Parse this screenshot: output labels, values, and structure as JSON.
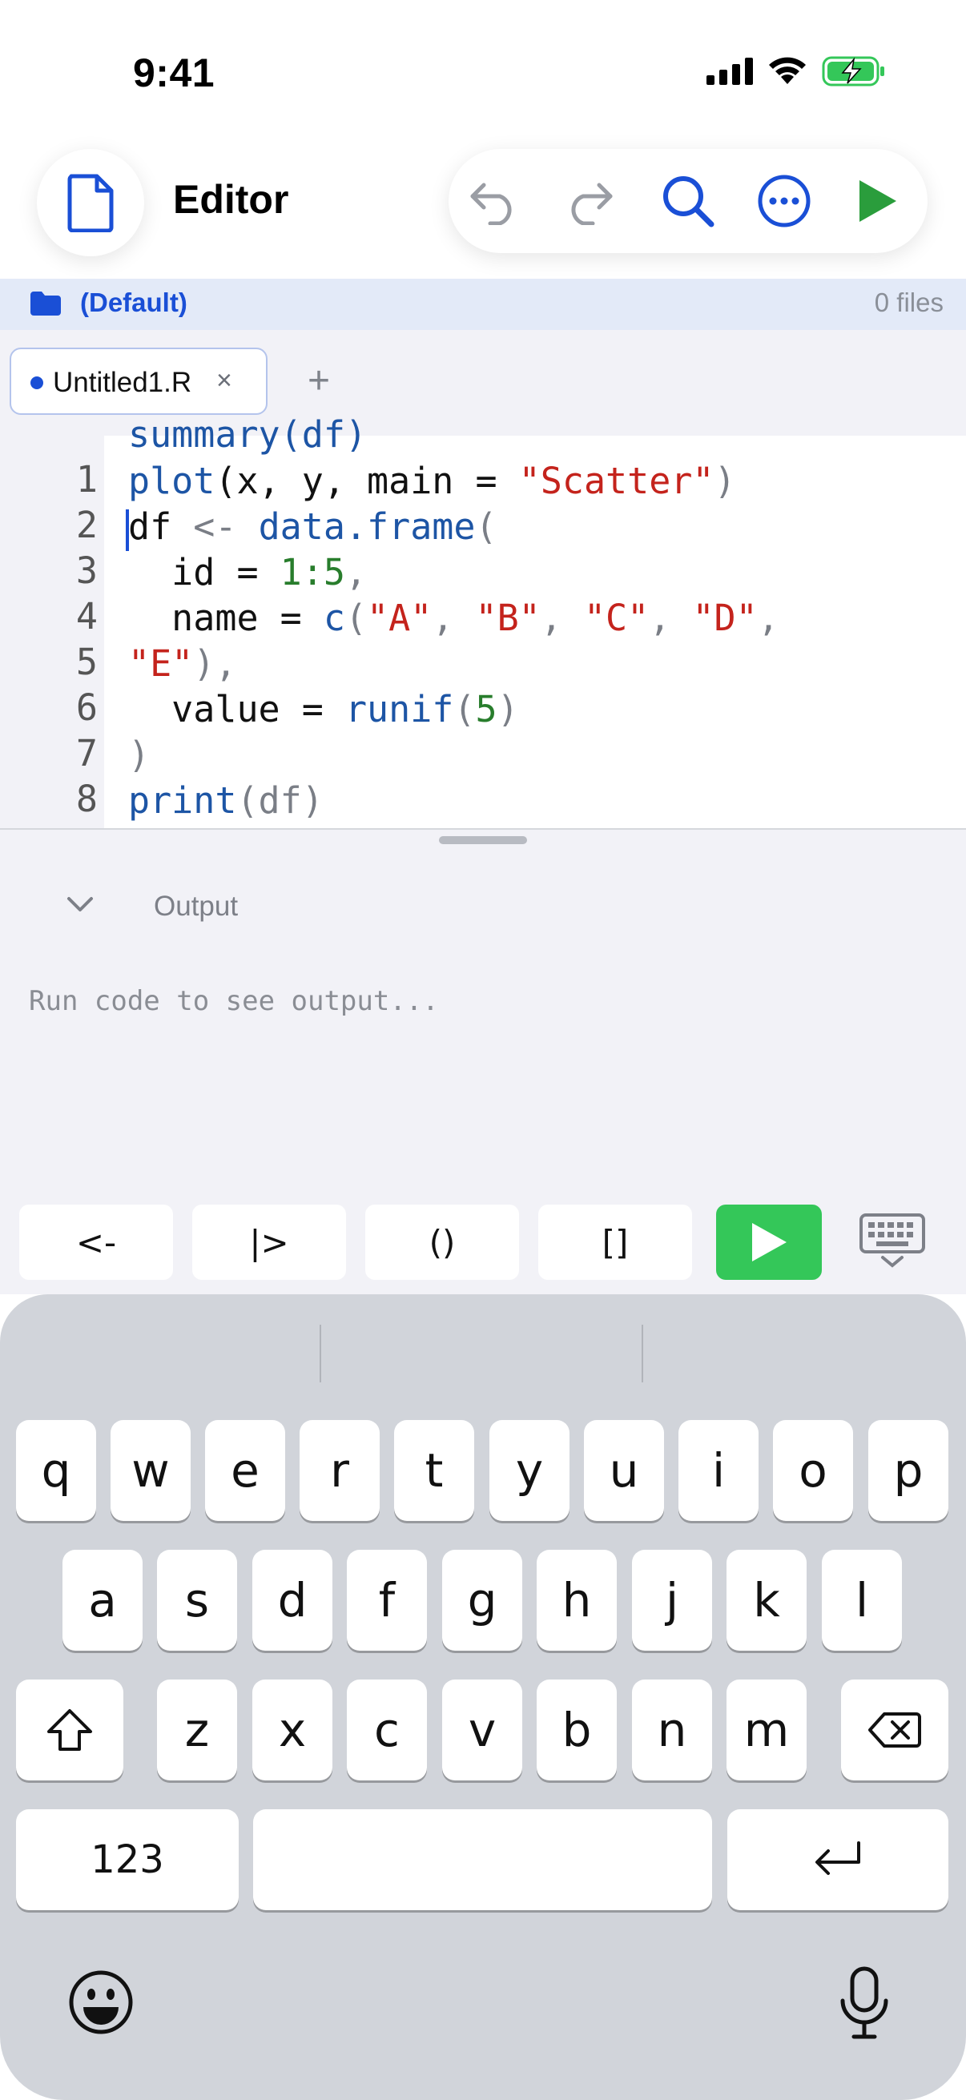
{
  "status_bar": {
    "time": "9:41"
  },
  "nav": {
    "title": "Editor"
  },
  "project": {
    "name": "(Default)",
    "files": "0 files"
  },
  "tabs": [
    {
      "label": "Untitled1.R",
      "close": "×"
    }
  ],
  "tab_add": "+",
  "editor": {
    "partial_line": "summary(df)",
    "line_numbers": [
      "1",
      "2",
      "3",
      "4",
      "5",
      "6",
      "7",
      "8"
    ],
    "lines": {
      "l1_a": "plot",
      "l1_b": "(x, y, main = ",
      "l1_c": "\"Scatter\"",
      "l1_d": ")",
      "l2_a": "df",
      "l2_b": " <- ",
      "l2_c": "data.frame",
      "l2_d": "(",
      "l3_a": "  id = ",
      "l3_b": "1",
      "l3_c": ":",
      "l3_d": "5",
      "l3_e": ",",
      "l4_a": "  name = ",
      "l4_b": "c",
      "l4_c": "(",
      "l4_d": "\"A\"",
      "l4_e": ", ",
      "l4_f": "\"B\"",
      "l4_g": ", ",
      "l4_h": "\"C\"",
      "l4_i": ", ",
      "l4_j": "\"D\"",
      "l4_k": ",",
      "l5_a": "\"E\"",
      "l5_b": "),",
      "l6_a": "  value = ",
      "l6_b": "runif",
      "l6_c": "(",
      "l6_d": "5",
      "l6_e": ")",
      "l7_a": ")",
      "l8_a": "print",
      "l8_b": "(df)"
    }
  },
  "output": {
    "title": "Output",
    "placeholder": "Run code to see output..."
  },
  "accessory": {
    "b1": "<-",
    "b2": "|>",
    "b3": "()",
    "b4": "[]"
  },
  "keyboard": {
    "row1": [
      "q",
      "w",
      "e",
      "r",
      "t",
      "y",
      "u",
      "i",
      "o",
      "p"
    ],
    "row2": [
      "a",
      "s",
      "d",
      "f",
      "g",
      "h",
      "j",
      "k",
      "l"
    ],
    "row3": [
      "z",
      "x",
      "c",
      "v",
      "b",
      "n",
      "m"
    ],
    "numbers_key": "123"
  },
  "colors": {
    "accent": "#1a4fd6",
    "run_green": "#34c759",
    "string": "#c4231c",
    "number": "#287d2c",
    "function": "#1d55a5"
  }
}
